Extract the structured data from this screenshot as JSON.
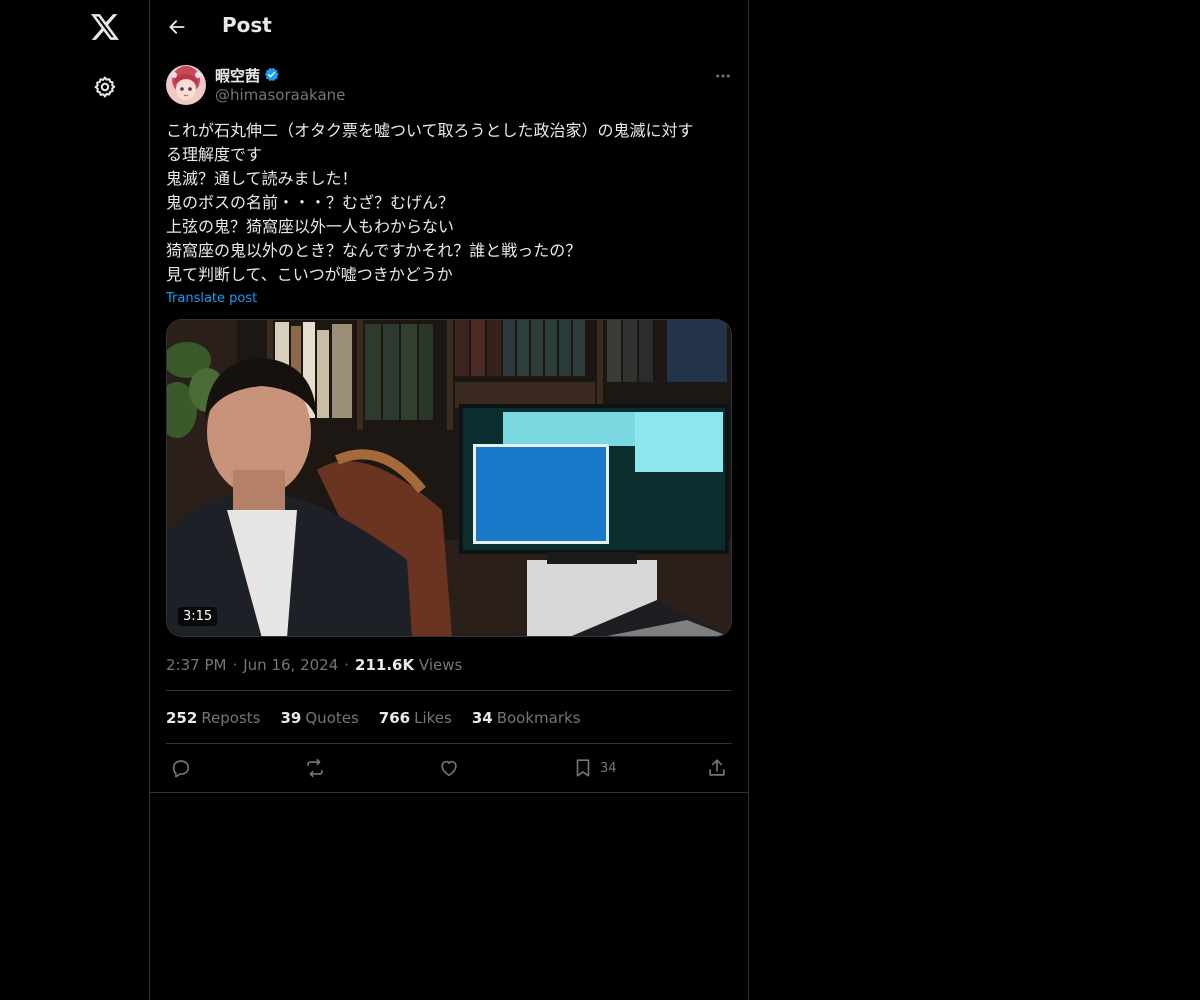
{
  "header": {
    "title": "Post"
  },
  "author": {
    "display_name": "暇空茜",
    "handle": "@himasoraakane",
    "verified": true
  },
  "post": {
    "lines": [
      "これが石丸伸二（オタク票を嘘ついて取ろうとした政治家）の鬼滅に対す",
      "る理解度です",
      "鬼滅？通して読みました！",
      "鬼のボスの名前・・・？むざ？むげん？",
      "上弦の鬼？猗窩座以外一人もわからない",
      "猗窩座の鬼以外のとき？なんですかそれ？誰と戦ったの？",
      "見て判断して、こいつが嘘つきかどうか"
    ],
    "translate_label": "Translate post"
  },
  "media": {
    "duration": "3:15"
  },
  "meta": {
    "time": "2:37 PM",
    "date": "Jun 16, 2024",
    "views_count": "211.6K",
    "views_label": "Views"
  },
  "stats": {
    "reposts_count": "252",
    "reposts_label": "Reposts",
    "quotes_count": "39",
    "quotes_label": "Quotes",
    "likes_count": "766",
    "likes_label": "Likes",
    "bookmarks_count": "34",
    "bookmarks_label": "Bookmarks"
  },
  "actions": {
    "bookmark_count": "34"
  },
  "icons": {
    "logo": "x-logo-icon",
    "settings": "gear-icon",
    "back": "arrow-left-icon",
    "more": "more-horizontal-icon",
    "reply": "reply-icon",
    "repost": "repost-icon",
    "like": "heart-icon",
    "bookmark": "bookmark-icon",
    "share": "share-icon",
    "verified": "verified-badge-icon"
  },
  "colors": {
    "accent": "#1d9bf0",
    "background": "#000000",
    "text": "#e7e9ea",
    "muted": "#71767b",
    "border": "#2f3336"
  }
}
